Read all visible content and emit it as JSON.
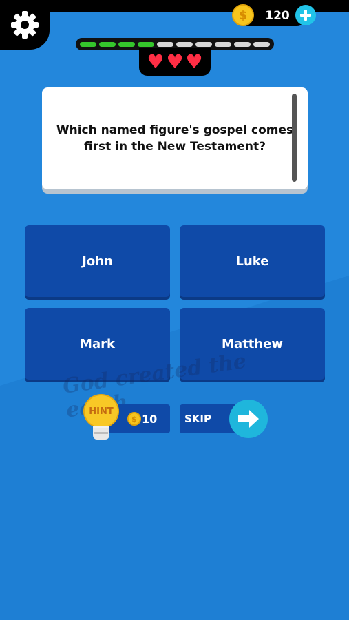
{
  "colors": {
    "background": "#2387dc",
    "answer_tile": "#0f4aa8",
    "progress_done": "#35c62c",
    "progress_todo": "#d7d7d7",
    "heart": "#ff2e44",
    "coin": "#f7c51d",
    "accent": "#1fb6dc"
  },
  "icons": {
    "settings": "gear-icon",
    "coin": "coin-icon",
    "add": "plus-icon",
    "life": "heart-icon",
    "hint": "lightbulb-icon",
    "skip": "arrow-right-icon"
  },
  "header": {
    "coin_symbol": "$",
    "coins": "120"
  },
  "progress": {
    "completed": 4,
    "total": 10
  },
  "lives": {
    "count": 3
  },
  "question": {
    "text": "Which named figure's gospel comes first in the New Testament?"
  },
  "answers": [
    "John",
    "Luke",
    "Mark",
    "Matthew"
  ],
  "hint": {
    "label": "HINT",
    "coin_symbol": "$",
    "cost": "10"
  },
  "skip": {
    "label": "SKIP"
  },
  "watermark": {
    "text": "God created the earth"
  }
}
